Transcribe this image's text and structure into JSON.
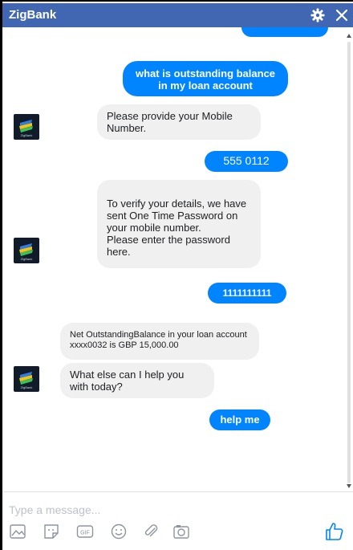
{
  "window": {
    "title": "ZigBank"
  },
  "avatar": {
    "caption": "ZigBank"
  },
  "messages": [
    {
      "sender": "user",
      "text": "what is outstanding balance in my loan account"
    },
    {
      "sender": "bot",
      "text": "Please provide your Mobile Number."
    },
    {
      "sender": "user",
      "text": "555 0112"
    },
    {
      "sender": "bot",
      "text": "To verify your details, we have sent One Time Password on your mobile number.\nPlease enter the password here."
    },
    {
      "sender": "user",
      "text": "1111111111"
    },
    {
      "sender": "bot",
      "text": "Net OutstandingBalance in your loan account xxxx0032 is GBP 15,000.00"
    },
    {
      "sender": "bot",
      "text": "What else can I help you with today?"
    },
    {
      "sender": "user",
      "text": "help me"
    }
  ],
  "composer": {
    "placeholder": "Type a message..."
  },
  "toolbar_icons": [
    "image-icon",
    "sticker-icon",
    "gif-icon",
    "emoji-icon",
    "attachment-icon",
    "camera-icon"
  ],
  "colors": {
    "header": "#4267b2",
    "user_bubble": "#0084ff",
    "bot_bubble": "#f1f0f0",
    "accent": "#0084ff"
  }
}
